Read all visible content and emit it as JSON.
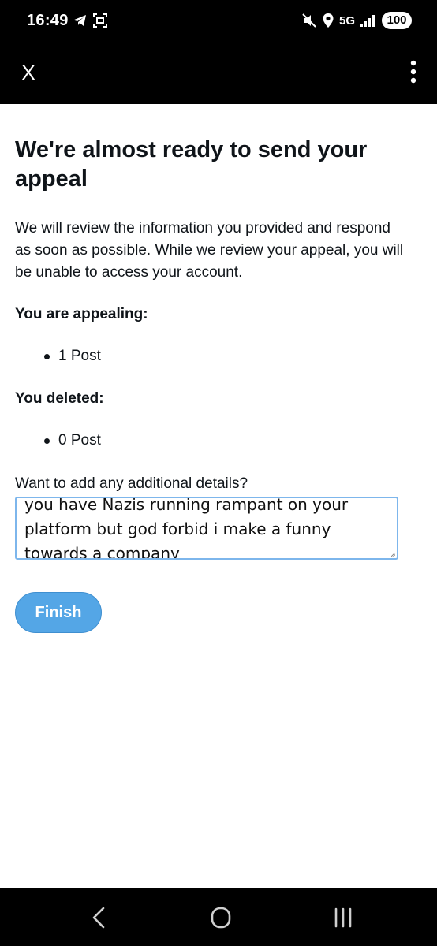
{
  "status_bar": {
    "time": "16:49",
    "network": "5G",
    "battery": "100",
    "icons": [
      "telegram-icon",
      "screenshot-icon",
      "mute-icon",
      "location-icon",
      "signal-icon",
      "battery-icon"
    ]
  },
  "app_bar": {
    "close_label": "X",
    "menu_icon": "more-vertical-icon"
  },
  "main": {
    "title": "We're almost ready to send your appeal",
    "description": "We will review the information you provided and respond as soon as possible. While we review your appeal, you will be unable to access your account.",
    "appealing_label": "You are appealing:",
    "appealing_items": [
      "1 Post"
    ],
    "deleted_label": "You deleted:",
    "deleted_items": [
      "0 Post"
    ],
    "details_label": "Want to add any additional details?",
    "details_value": "you have Nazis running rampant on your platform but god forbid i make a funny towards a company",
    "finish_label": "Finish"
  },
  "colors": {
    "accent": "#54a6e6",
    "textarea_border": "#7db6ec",
    "bars": "#000000"
  },
  "nav_bar": {
    "icons": [
      "back-icon",
      "home-icon",
      "recents-icon"
    ]
  }
}
